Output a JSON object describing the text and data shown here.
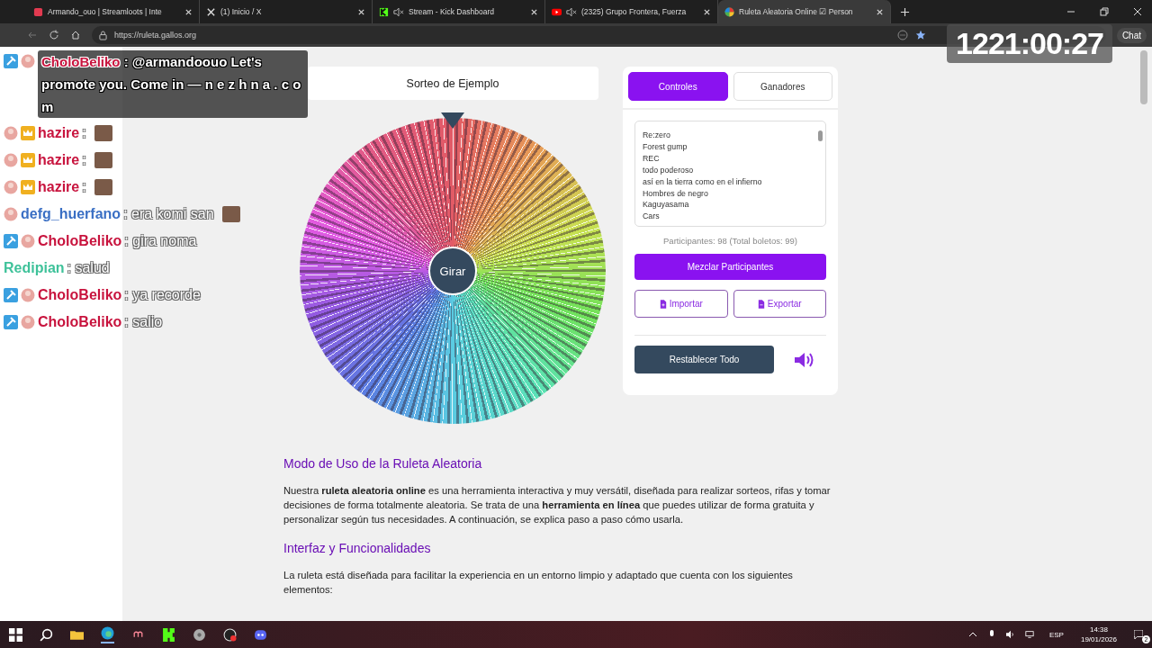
{
  "browser": {
    "tabs": [
      {
        "title": "Armando_ouo | Streamloots | Inte",
        "muted": false,
        "selected": false
      },
      {
        "title": "(1) Inicio / X",
        "muted": false,
        "selected": false
      },
      {
        "title": "Stream - Kick Dashboard",
        "muted": true,
        "selected": false
      },
      {
        "title": "(2325) Grupo Frontera, Fuerza",
        "muted": true,
        "selected": false
      },
      {
        "title": "Ruleta Aleatoria Online ☑ Person",
        "muted": false,
        "selected": true
      }
    ],
    "address": "https://ruleta.gallos.org",
    "chat_button": "Chat"
  },
  "page": {
    "wheel_title": "Sorteo de Ejemplo",
    "spin_button": "Girar",
    "panel_tabs": [
      {
        "label": "Controles",
        "selected": true
      },
      {
        "label": "Ganadores",
        "selected": false
      }
    ],
    "participants": [
      "Re:zero",
      "Forest gump",
      "REC",
      "todo poderoso",
      "así en la tierra como en el infierno",
      "Hombres de negro",
      "Kaguyasama",
      "Cars"
    ],
    "count": "Participantes: 98 (Total boletos: 99)",
    "shuffle_button": "Mezclar Participantes",
    "import_button": "Importar",
    "export_button": "Exportar",
    "reset_button": "Restablecer Todo",
    "article": [
      {
        "kind": "heading",
        "text": "Modo de Uso de la Ruleta Aleatoria"
      },
      {
        "kind": "paragraph",
        "text": "Nuestra **ruleta aleatoria online** es una herramienta interactiva y muy versátil, diseñada para realizar sorteos, rifas y tomar decisiones de forma totalmente aleatoria. Se trata de una **herramienta en línea** que puedes utilizar de forma gratuita y personalizar según tus necesidades. A continuación, se explica paso a paso cómo usarla."
      },
      {
        "kind": "heading",
        "text": "Interfaz y Funcionalidades"
      },
      {
        "kind": "paragraph",
        "text": "La ruleta está diseñada para facilitar la experiencia en un entorno limpio y adaptado que cuenta con los siguientes elementos:"
      }
    ]
  },
  "overlay": {
    "timer": "1221:00:27",
    "chat": [
      {
        "kind": "mod",
        "name": "CholoBeliko",
        "color": "#c8143e",
        "message": ": @armandoouo Let's promote you. Come in — n e z h n a . c o m",
        "emote": false
      },
      {
        "kind": "sub",
        "name": "hazire",
        "color": "#c8143e",
        "message": ":",
        "emote": true
      },
      {
        "kind": "sub",
        "name": "hazire",
        "color": "#c8143e",
        "message": ":",
        "emote": true
      },
      {
        "kind": "sub",
        "name": "hazire",
        "color": "#c8143e",
        "message": ":",
        "emote": true
      },
      {
        "kind": "viewer",
        "name": "defg_huerfano",
        "color": "#3a6fc4",
        "message": ": era komi san",
        "emote": true
      },
      {
        "kind": "mod",
        "name": "CholoBeliko",
        "color": "#c8143e",
        "message": ": gira noma",
        "emote": false
      },
      {
        "kind": "plain",
        "name": "Redipian",
        "color": "#3fc29a",
        "message": ": salud",
        "emote": false
      },
      {
        "kind": "mod",
        "name": "CholoBeliko",
        "color": "#c8143e",
        "message": ": ya recorde",
        "emote": false
      },
      {
        "kind": "mod",
        "name": "CholoBeliko",
        "color": "#c8143e",
        "message": ": salio",
        "emote": false
      }
    ]
  },
  "taskbar": {
    "language": "ESP",
    "time": "14:38",
    "date": "19/01/2026",
    "notifications": "2"
  }
}
